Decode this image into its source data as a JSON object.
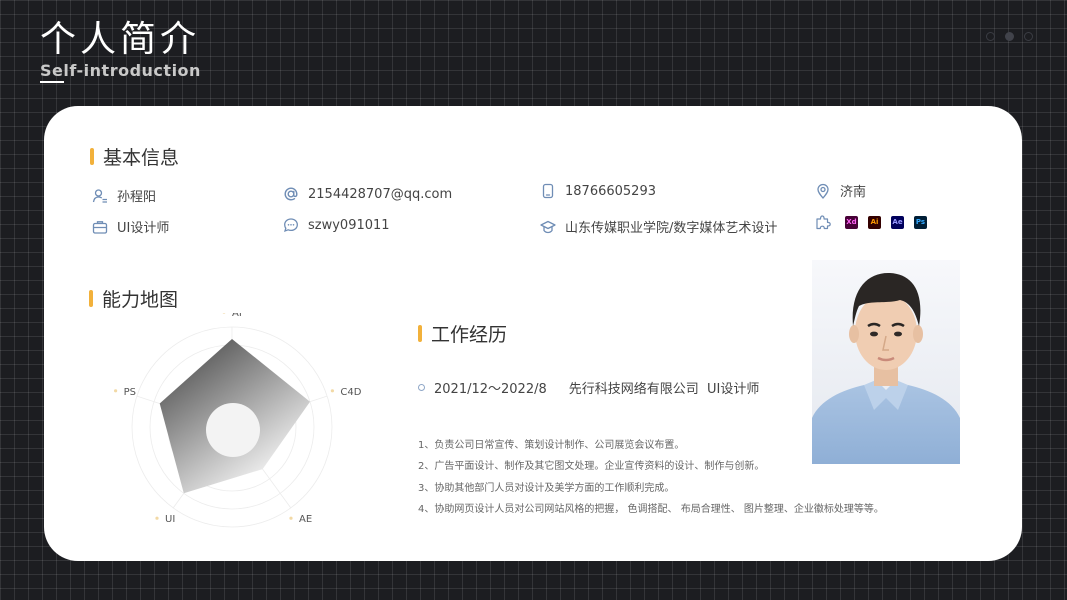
{
  "header": {
    "title": "个人简介",
    "subtitle": "Self-introduction"
  },
  "basic_info": {
    "heading": "基本信息",
    "name": "孙程阳",
    "email": "2154428707@qq.com",
    "phone": "18766605293",
    "city": "济南",
    "position": "UI设计师",
    "wechat": "szwy091011",
    "education": "山东传媒职业学院/数字媒体艺术设计",
    "skills": [
      "Xd",
      "Ai",
      "Ae",
      "Ps"
    ]
  },
  "ability_map": {
    "heading": "能力地图"
  },
  "chart_data": {
    "type": "radar",
    "axes": [
      "AI",
      "C4D",
      "AE",
      "UI",
      "PS"
    ],
    "values": [
      0.88,
      0.82,
      0.52,
      0.82,
      0.76
    ],
    "max": 1
  },
  "work": {
    "heading": "工作经历",
    "period": "2021/12～2022/8",
    "company_role": "先行科技网络有限公司  UI设计师",
    "duties": [
      "1、负责公司日常宣传、策划设计制作、公司展览会议布置。",
      "2、广告平面设计、制作及其它图文处理。企业宣传资料的设计、制作与创新。",
      "3、协助其他部门人员对设计及美学方面的工作顺利完成。",
      "4、协助网页设计人员对公司网站风格的把握， 色调搭配、 布局合理性、 图片整理、企业徽标处理等等。"
    ]
  },
  "colors": {
    "accent": "#f2b13b",
    "icon": "#6f8db5",
    "card": "#ffffff",
    "background": "#1c1d21"
  },
  "skill_colors": {
    "Xd": {
      "bg": "#470137",
      "fg": "#ff61f6"
    },
    "Ai": {
      "bg": "#330000",
      "fg": "#ff9a00"
    },
    "Ae": {
      "bg": "#00005b",
      "fg": "#9999ff"
    },
    "Ps": {
      "bg": "#001e36",
      "fg": "#31a8ff"
    }
  },
  "icons": {
    "name": "user-icon",
    "email": "at-icon",
    "phone": "phone-icon",
    "city": "location-pin-icon",
    "position": "briefcase-icon",
    "wechat": "chat-bubble-icon",
    "education": "graduation-cap-icon",
    "skills": "puzzle-icon"
  }
}
